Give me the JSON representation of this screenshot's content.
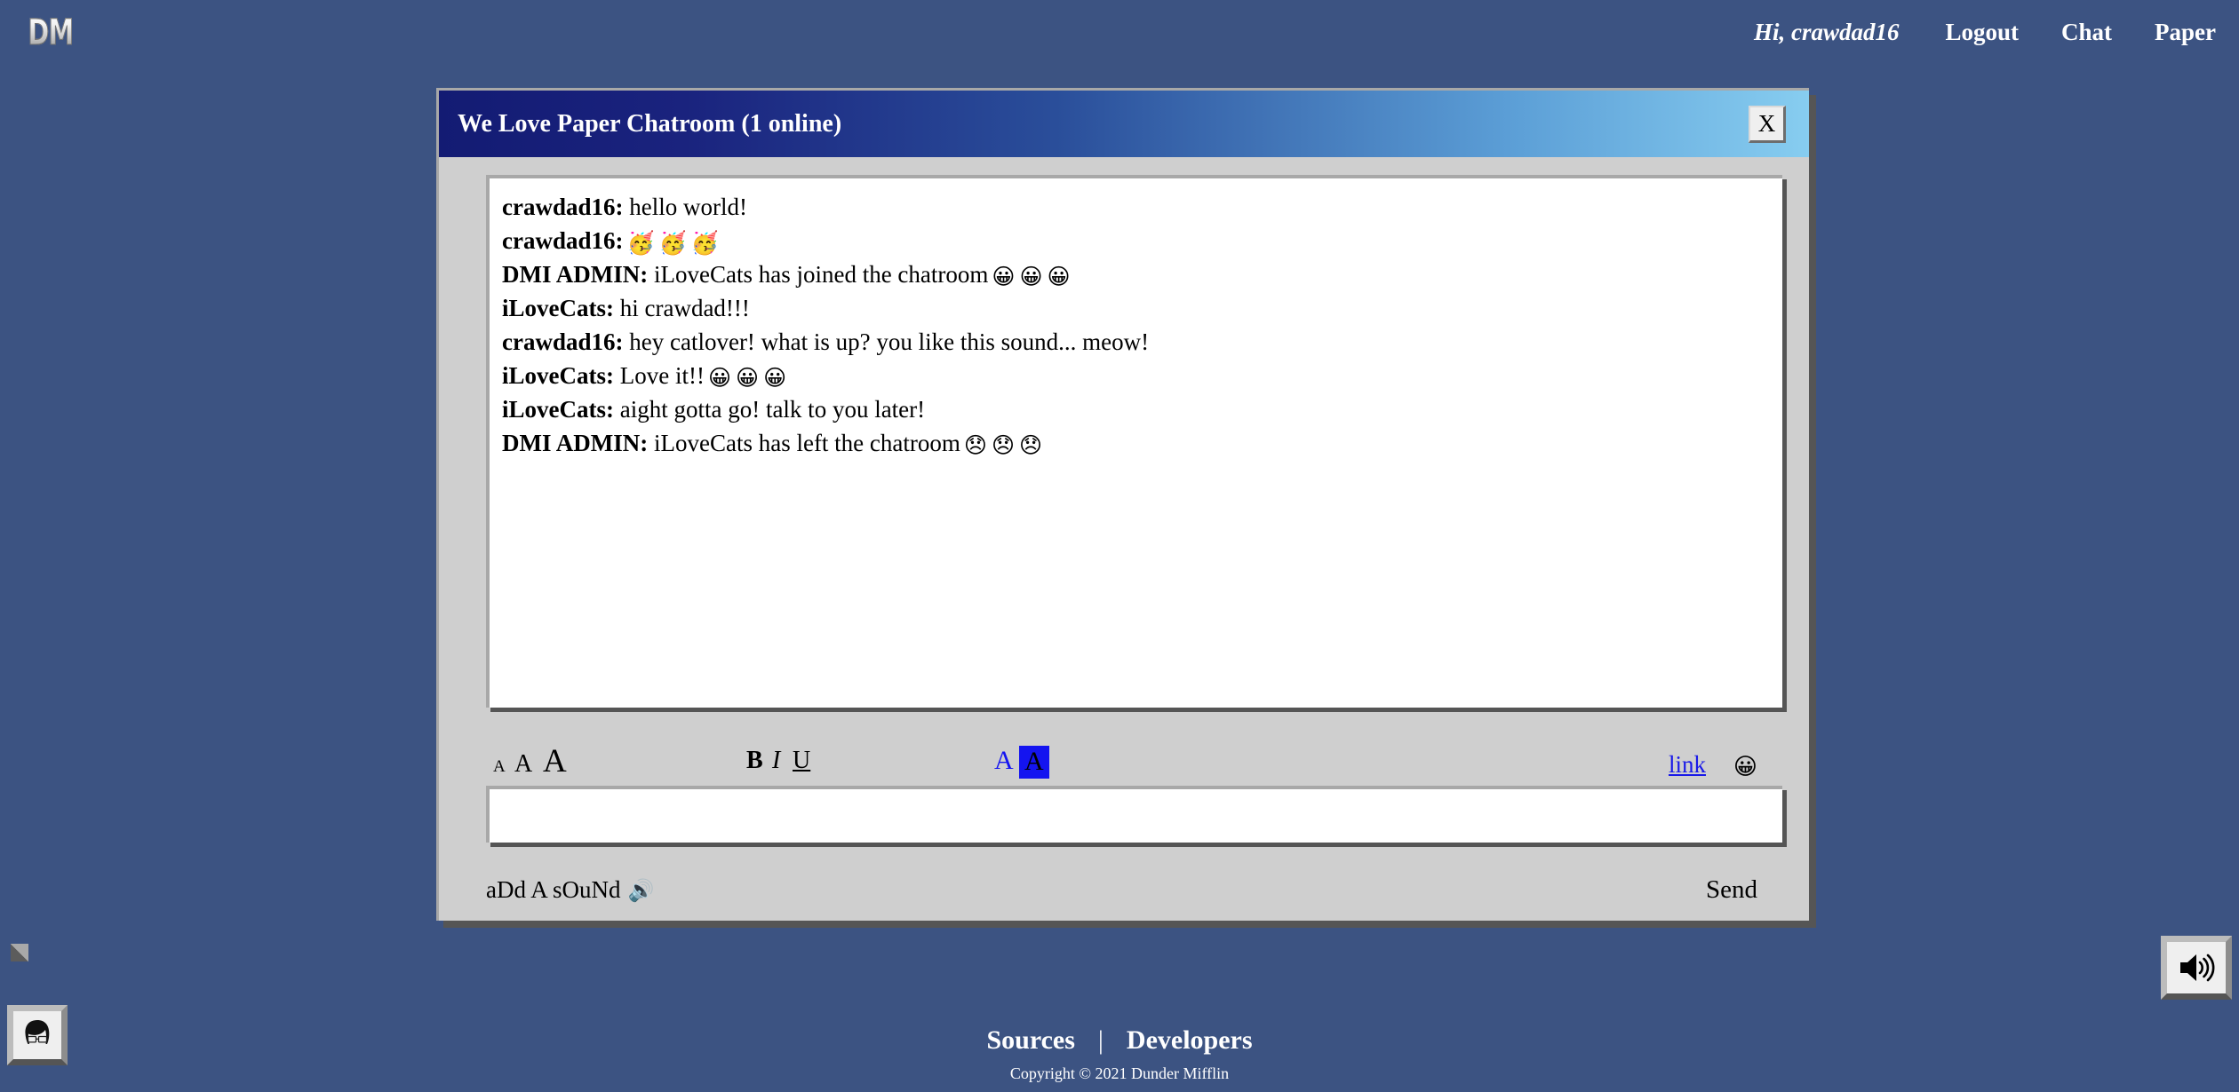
{
  "nav": {
    "logo": "DM",
    "greeting": "Hi, crawdad16",
    "links": [
      {
        "label": "Logout",
        "name": "nav-logout"
      },
      {
        "label": "Chat",
        "name": "nav-chat"
      },
      {
        "label": "Paper",
        "name": "nav-paper"
      }
    ]
  },
  "window": {
    "title": "We Love Paper Chatroom (1 online)",
    "close_label": "X"
  },
  "messages": [
    {
      "who": "crawdad16:",
      "body": " hello world!",
      "emoji": ""
    },
    {
      "who": "crawdad16:",
      "body": "",
      "emoji": "🥳🥳🥳"
    },
    {
      "who": "DMI ADMIN:",
      "body": " iLoveCats has joined the chatroom",
      "emoji": "😀😀😀"
    },
    {
      "who": "iLoveCats:",
      "body": " hi crawdad!!!",
      "emoji": ""
    },
    {
      "who": "crawdad16:",
      "body": " hey catlover! what is up? you like this sound... meow!",
      "emoji": ""
    },
    {
      "who": "iLoveCats:",
      "body": " Love it!!",
      "emoji": "😀😀😀"
    },
    {
      "who": "iLoveCats:",
      "body": " aight gotta go! talk to you later!",
      "emoji": ""
    },
    {
      "who": "DMI ADMIN:",
      "body": " iLoveCats has left the chatroom",
      "emoji": "😞😞😞"
    }
  ],
  "toolbar": {
    "font_small": "A",
    "font_medium": "A",
    "font_large": "A",
    "bold": "B",
    "italic": "I",
    "underline": "U",
    "text_color": "A",
    "highlight_color": "A",
    "link_label": "link",
    "emoji_label": "😀",
    "text_color_hex": "#1414f0",
    "highlight_hex": "#1414f0"
  },
  "composer": {
    "value": "",
    "placeholder": ""
  },
  "actions": {
    "add_sound_label": "aDd A sOuNd",
    "add_sound_icon": "🔊",
    "send_label": "Send"
  },
  "footer": {
    "links": [
      {
        "label": "Sources",
        "name": "footer-sources"
      },
      {
        "label": "Developers",
        "name": "footer-developers"
      }
    ],
    "separator": "|",
    "copyright": "Copyright © 2021 Dunder Mifflin"
  },
  "theme": {
    "page_background": "#3c5382",
    "titlebar_start": "#131b73",
    "titlebar_end": "#87cdf0",
    "window_body": "#cfcfcf"
  }
}
